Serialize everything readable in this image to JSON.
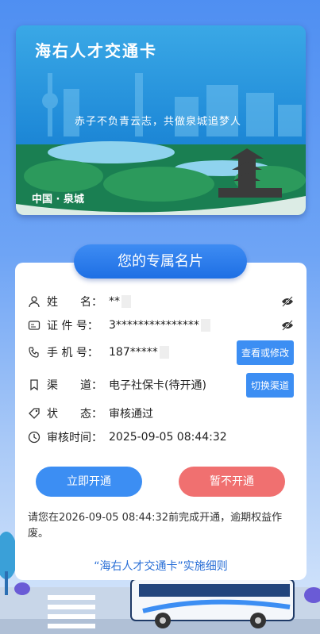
{
  "card": {
    "title": "海右人才交通卡",
    "slogan": "赤子不负青云志，共做泉城追梦人",
    "city": "中国 · 泉城"
  },
  "header_pill": "您的专属名片",
  "rows": {
    "name": {
      "label": "姓　　名：",
      "value": "**"
    },
    "id": {
      "label": "证 件 号：",
      "value": "3***************"
    },
    "phone": {
      "label": "手 机 号：",
      "value": "187*****",
      "button": "查看或修改"
    },
    "channel": {
      "label": "渠　　道：",
      "value": "电子社保卡(待开通)",
      "button": "切换渠道"
    },
    "status": {
      "label": "状　　态：",
      "value": "审核通过"
    },
    "time": {
      "label": "审核时间：",
      "value": "2025-09-05 08:44:32"
    }
  },
  "actions": {
    "open": "立即开通",
    "defer": "暂不开通"
  },
  "notice": "请您在2026-09-05 08:44:32前完成开通，逾期权益作废。",
  "link": "“海右人才交通卡”实施细则",
  "colors": {
    "primary": "#3c8ef3",
    "danger": "#f07070",
    "link": "#2a6fd6"
  }
}
